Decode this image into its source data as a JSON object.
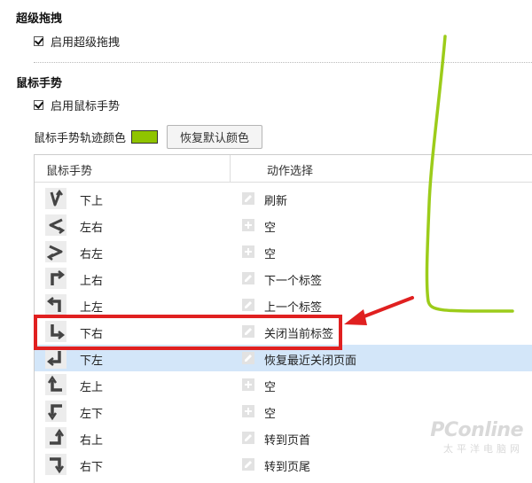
{
  "super_drag": {
    "title": "超级拖拽",
    "enable_label": "启用超级拖拽",
    "enabled": true
  },
  "mouse_gesture": {
    "title": "鼠标手势",
    "enable_label": "启用鼠标手势",
    "enabled": true,
    "trail_color_label": "鼠标手势轨迹颜色",
    "trail_color": "#8fc400",
    "reset_color_button": "恢复默认颜色"
  },
  "gesture_table": {
    "col_gesture": "鼠标手势",
    "col_action": "动作选择",
    "rows": [
      {
        "gesture": "下上",
        "gesture_icon": "down-up-gesture-icon",
        "action": "刷新",
        "action_icon": "edit-icon"
      },
      {
        "gesture": "左右",
        "gesture_icon": "left-right-gesture-icon",
        "action": "空",
        "action_icon": "add-icon"
      },
      {
        "gesture": "右左",
        "gesture_icon": "right-left-gesture-icon",
        "action": "空",
        "action_icon": "add-icon"
      },
      {
        "gesture": "上右",
        "gesture_icon": "up-right-gesture-icon",
        "action": "下一个标签",
        "action_icon": "edit-icon"
      },
      {
        "gesture": "上左",
        "gesture_icon": "up-left-gesture-icon",
        "action": "上一个标签",
        "action_icon": "edit-icon"
      },
      {
        "gesture": "下右",
        "gesture_icon": "down-right-gesture-icon",
        "action": "关闭当前标签",
        "action_icon": "edit-icon",
        "highlighted": true
      },
      {
        "gesture": "下左",
        "gesture_icon": "down-left-gesture-icon",
        "action": "恢复最近关闭页面",
        "action_icon": "edit-icon",
        "selected": true
      },
      {
        "gesture": "左上",
        "gesture_icon": "left-up-gesture-icon",
        "action": "空",
        "action_icon": "add-icon"
      },
      {
        "gesture": "左下",
        "gesture_icon": "left-down-gesture-icon",
        "action": "空",
        "action_icon": "add-icon"
      },
      {
        "gesture": "右上",
        "gesture_icon": "right-up-gesture-icon",
        "action": "转到页首",
        "action_icon": "edit-icon"
      },
      {
        "gesture": "右下",
        "gesture_icon": "right-down-gesture-icon",
        "action": "转到页尾",
        "action_icon": "edit-icon"
      }
    ]
  },
  "annotation": {
    "box_color": "#e02020",
    "gesture_stroke_color": "#9ccc1a"
  },
  "watermark": {
    "brand": "PConline",
    "subtitle": "太平洋电脑网"
  }
}
